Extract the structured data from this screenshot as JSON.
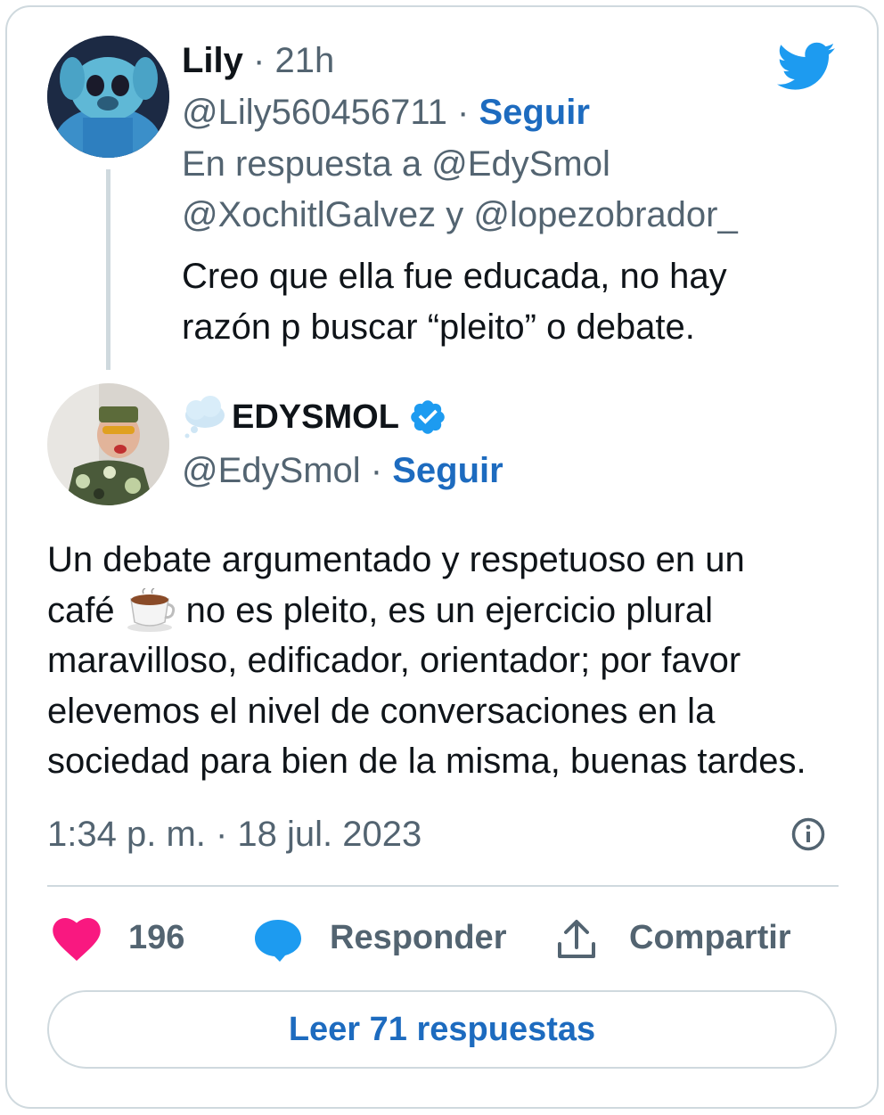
{
  "parent_tweet": {
    "name": "Lily",
    "time": "21h",
    "handle": "@Lily560456711",
    "follow": "Seguir",
    "reply_to_line1": "En respuesta a @EdySmol",
    "reply_to_line2": "@XochitlGalvez y @lopezobrador_",
    "text_line1": "Creo que ella fue educada, no hay",
    "text_line2": "razón p buscar “pleito” o debate."
  },
  "main_tweet": {
    "name": "EDYSMOL",
    "handle": "@EdySmol",
    "follow": "Seguir",
    "text_line1": "Un debate argumentado y respetuoso en un",
    "text_line2a": "café",
    "text_line2b": "no es pleito, es un ejercicio plural",
    "text_line3": "maravilloso, edificador, orientador; por favor",
    "text_line4": "elevemos el nivel de conversaciones en la",
    "text_line5": "sociedad para bien de la misma, buenas tardes.",
    "timestamp": "1:34 p. m. · 18 jul. 2023",
    "verified": true
  },
  "actions": {
    "likes": "196",
    "reply_label": "Responder",
    "share_label": "Compartir"
  },
  "read_replies": "Leer 71 respuestas",
  "colors": {
    "link_blue": "#1d6bbf",
    "twitter_blue": "#1d9bf0",
    "like_pink": "#f91880",
    "gray_text": "#536471",
    "border": "#cfd9de"
  },
  "icons": [
    "twitter-bird-icon",
    "verified-badge-icon",
    "cloud-emoji-icon",
    "coffee-emoji-icon",
    "info-icon",
    "heart-icon",
    "reply-bubble-icon",
    "share-icon"
  ]
}
